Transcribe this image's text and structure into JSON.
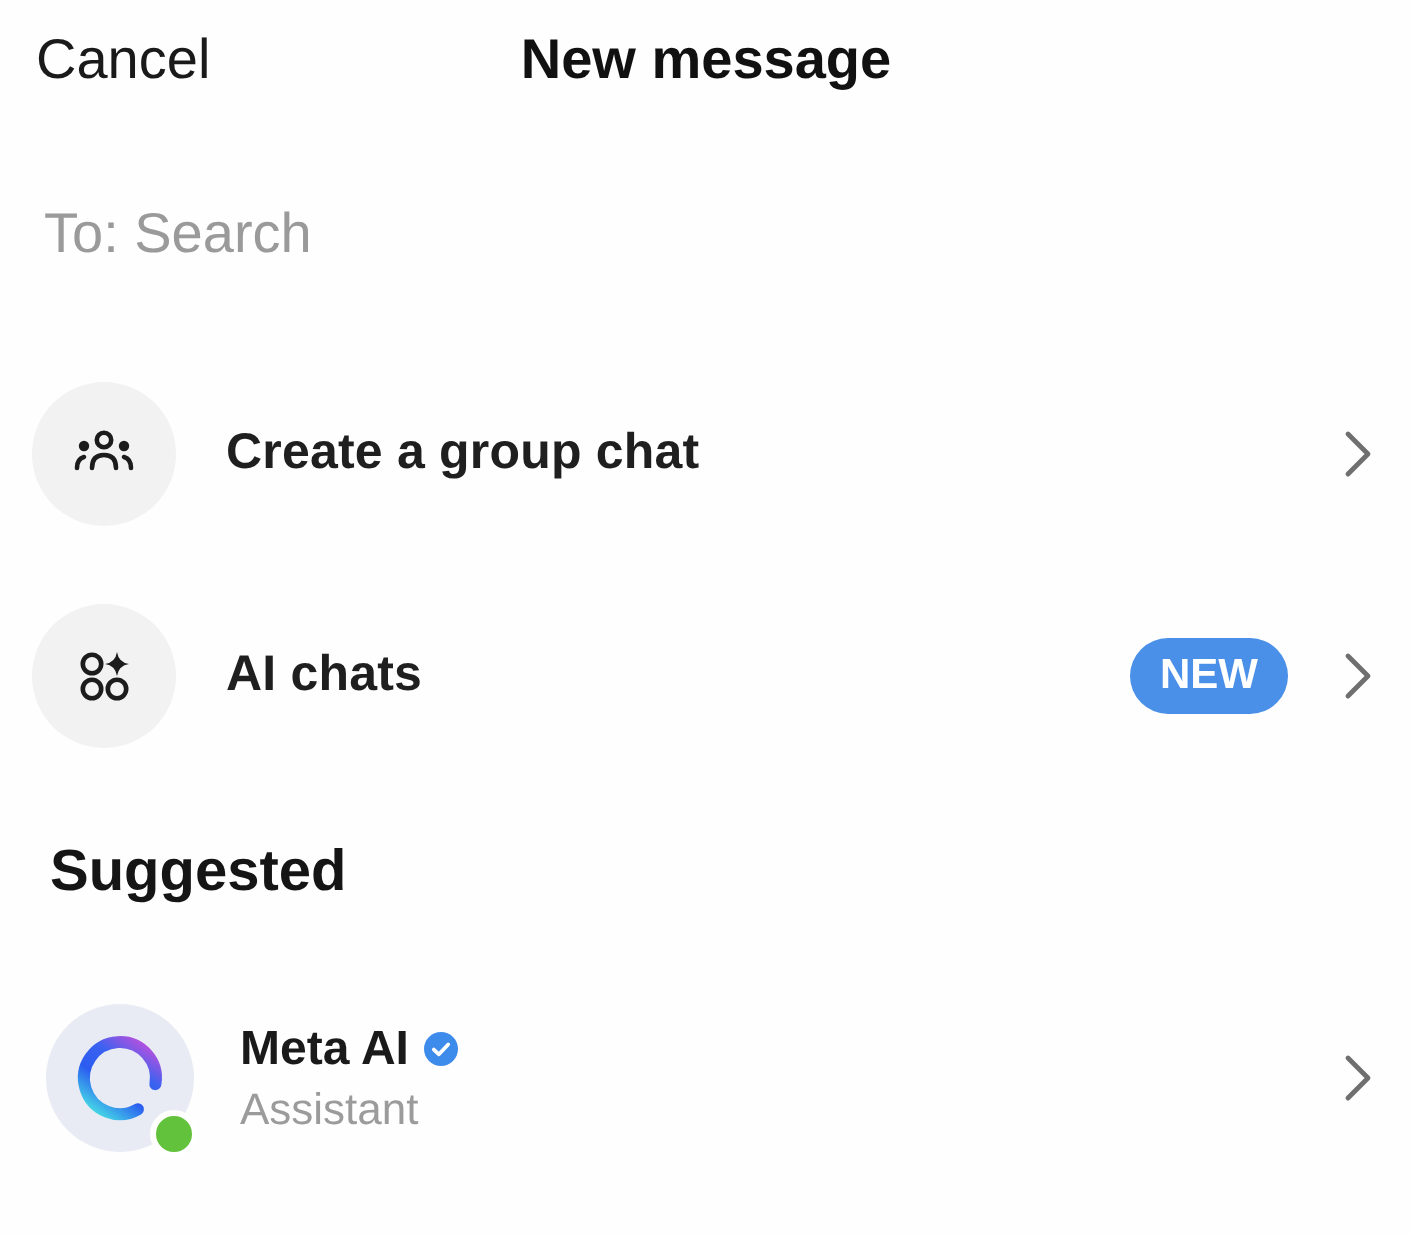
{
  "header": {
    "cancel": "Cancel",
    "title": "New message"
  },
  "search": {
    "placeholder": "To: Search"
  },
  "actions": [
    {
      "kind": "group",
      "label": "Create a group chat"
    },
    {
      "kind": "ai",
      "label": "AI chats",
      "badge": "NEW"
    }
  ],
  "suggested": {
    "heading": "Suggested",
    "contacts": [
      {
        "name": "Meta AI",
        "subtitle": "Assistant",
        "verified": true,
        "online": true
      }
    ]
  }
}
